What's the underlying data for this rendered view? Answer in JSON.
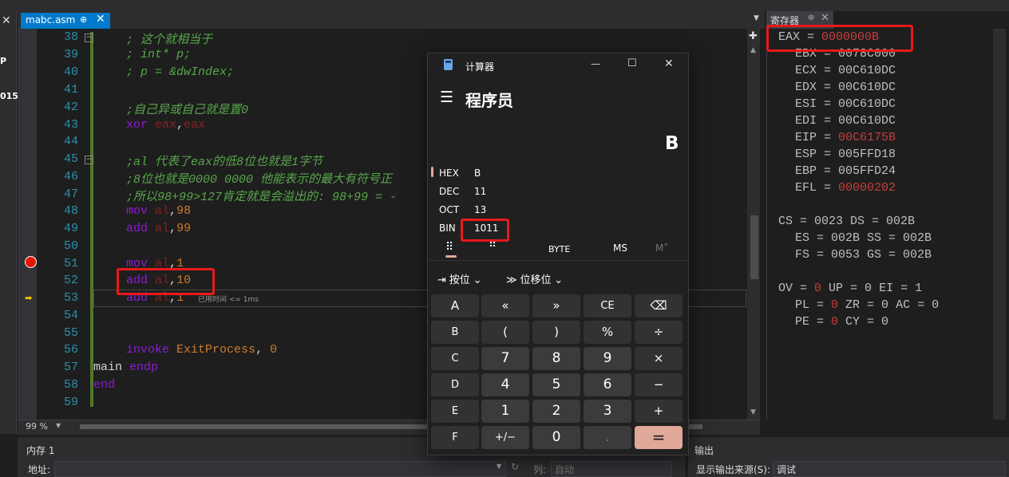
{
  "editor": {
    "tab_title": "mabc.asm",
    "tab_pin": "⊕",
    "tab_close": "✕",
    "zoom": "99 %",
    "elapsed_hint": "已用时间 <= 1ms",
    "lines": [
      {
        "n": "38"
      },
      {
        "n": "39"
      },
      {
        "n": "40"
      },
      {
        "n": "41"
      },
      {
        "n": "42"
      },
      {
        "n": "43"
      },
      {
        "n": "44"
      },
      {
        "n": "45"
      },
      {
        "n": "46"
      },
      {
        "n": "47"
      },
      {
        "n": "48"
      },
      {
        "n": "49"
      },
      {
        "n": "50"
      },
      {
        "n": "51"
      },
      {
        "n": "52"
      },
      {
        "n": "53"
      },
      {
        "n": "54"
      },
      {
        "n": "55"
      },
      {
        "n": "56"
      },
      {
        "n": "57"
      },
      {
        "n": "58"
      },
      {
        "n": "59"
      }
    ],
    "code": {
      "l38": "; 这个就相当于",
      "l39": "; int* p;",
      "l40": "; p = &dwIndex;",
      "l42": ";自己异或自己就是置0",
      "l43_op": "xor",
      "l43_a": "eax",
      "l43_b": "eax",
      "l45": ";al 代表了eax的低8位也就是1字节",
      "l46": ";8位也就是0000 0000 他能表示的最大有符号正",
      "l47": ";所以98+99>127肯定就是会溢出的: 98+99 = -",
      "l48_op": "mov",
      "l48_a": "al",
      "l48_b": "98",
      "l49_op": "add",
      "l49_a": "al",
      "l49_b": "99",
      "l51_op": "mov",
      "l51_a": "al",
      "l51_b": "1",
      "l52_op": "add",
      "l52_a": "al",
      "l52_b": "10",
      "l53_op": "add",
      "l53_a": "al",
      "l53_b": "1",
      "l56_op": "invoke",
      "l56_fn": "ExitProcess",
      "l56_arg": "0",
      "l57_a": "main",
      "l57_b": "endp",
      "l58": "end"
    }
  },
  "sidebar": {
    "glyph1": "P",
    "glyph2": "015",
    "close": "✕"
  },
  "registers": {
    "tab_title": "寄存器",
    "tab_pin": "⊕",
    "tab_close": "✕",
    "rows": [
      {
        "name": "EAX",
        "value": "0000000B",
        "changed": true
      },
      {
        "name": "EBX",
        "value": "0078C000",
        "changed": false
      },
      {
        "name": "ECX",
        "value": "00C610DC",
        "changed": false
      },
      {
        "name": "EDX",
        "value": "00C610DC",
        "changed": false
      },
      {
        "name": "ESI",
        "value": "00C610DC",
        "changed": false
      },
      {
        "name": "EDI",
        "value": "00C610DC",
        "changed": false
      },
      {
        "name": "EIP",
        "value": "00C6175B",
        "changed": true
      },
      {
        "name": "ESP",
        "value": "005FFD18",
        "changed": false
      },
      {
        "name": "EBP",
        "value": "005FFD24",
        "changed": false
      },
      {
        "name": "EFL",
        "value": "00000202",
        "changed": true
      }
    ],
    "segments": {
      "cs": "0023",
      "ds": "002B",
      "es": "002B",
      "ss": "002B",
      "fs": "0053",
      "gs": "002B"
    },
    "flags": {
      "ov": "0",
      "up": "0",
      "ei": "1",
      "pl": "0",
      "zr": "0",
      "ac": "0",
      "pe": "0",
      "cy": "0"
    }
  },
  "calculator": {
    "title": "计算器",
    "min": "—",
    "max": "☐",
    "close": "✕",
    "menu": "☰",
    "mode": "程序员",
    "display": "B",
    "radix": [
      {
        "label": "HEX",
        "value": "B"
      },
      {
        "label": "DEC",
        "value": "11"
      },
      {
        "label": "OCT",
        "value": "13"
      },
      {
        "label": "BIN",
        "value": "1011"
      }
    ],
    "word_size": "BYTE",
    "memory": "MS",
    "memory_more": "M˅",
    "bitwise": "按位",
    "bitshift": "位移位",
    "chevron": "⌄",
    "keys": [
      [
        "A",
        "«",
        "»",
        "CE",
        "⌫"
      ],
      [
        "B",
        "(",
        ")",
        "%",
        "÷"
      ],
      [
        "C",
        "7",
        "8",
        "9",
        "×"
      ],
      [
        "D",
        "4",
        "5",
        "6",
        "−"
      ],
      [
        "E",
        "1",
        "2",
        "3",
        "+"
      ],
      [
        "F",
        "+/−",
        "0",
        ".",
        "="
      ]
    ]
  },
  "bottom": {
    "memory_title": "内存 1",
    "address_label": "地址:",
    "column_label": "列:",
    "column_value": "自动",
    "output_title": "输出",
    "output_source_label": "显示输出来源(S):",
    "output_source_value": "调试"
  },
  "colors": {
    "accent": "#007acc",
    "changed_register": "#c33f3f",
    "highlight_box": "#e8191a",
    "equals_key": "#e0a898"
  }
}
